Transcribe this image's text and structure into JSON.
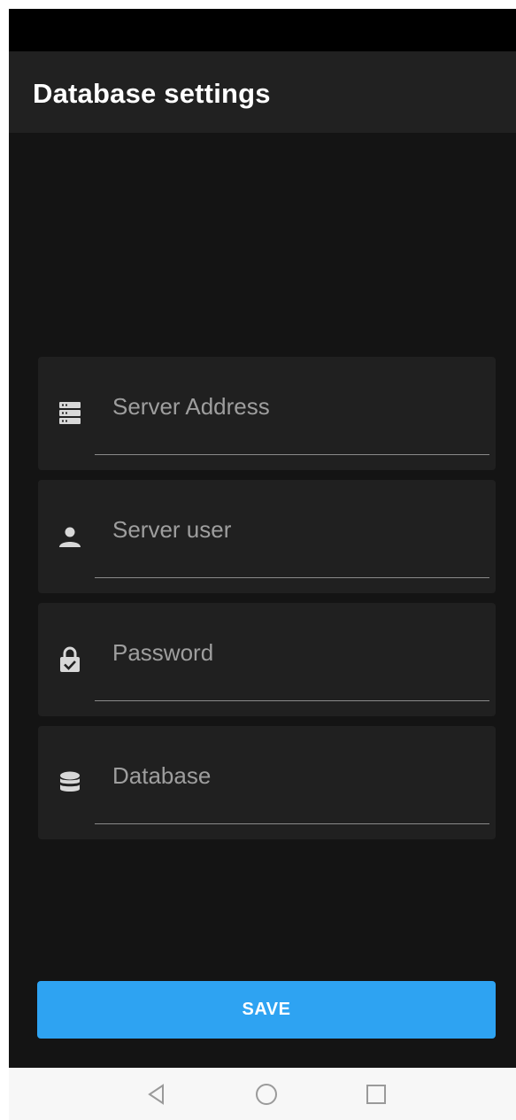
{
  "app_bar": {
    "title": "Database settings"
  },
  "form": {
    "fields": [
      {
        "name": "server-address",
        "icon": "server-icon",
        "placeholder": "Server Address",
        "value": ""
      },
      {
        "name": "server-user",
        "icon": "person-icon",
        "placeholder": "Server user",
        "value": ""
      },
      {
        "name": "password",
        "icon": "lock-check-icon",
        "placeholder": "Password",
        "value": ""
      },
      {
        "name": "database",
        "icon": "database-icon",
        "placeholder": "Database",
        "value": ""
      }
    ],
    "save_label": "SAVE"
  },
  "nav": {
    "items": [
      "back-icon",
      "home-icon",
      "recents-icon"
    ]
  },
  "colors": {
    "background": "#141414",
    "app_bar": "#212121",
    "field": "#202020",
    "accent": "#2ea3f2",
    "icon": "#d8d8d8"
  }
}
